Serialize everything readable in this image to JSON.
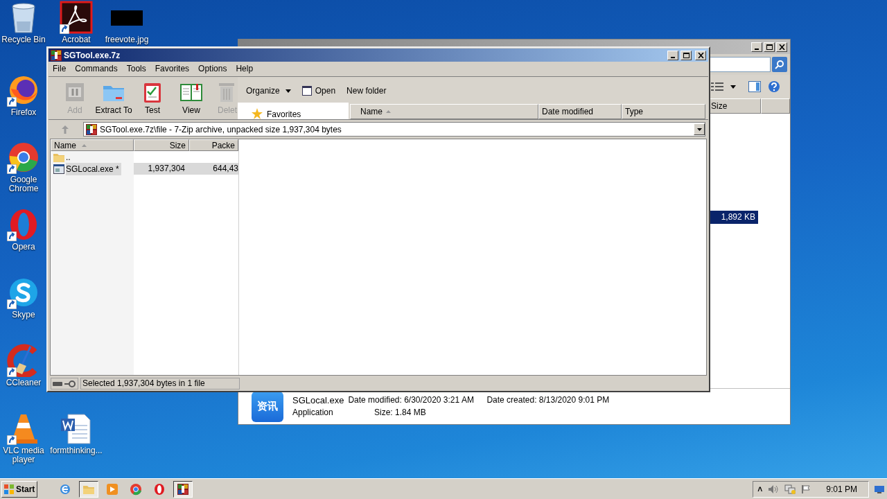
{
  "desktop_icons": [
    {
      "label": "Recycle Bin",
      "kind": "recycle",
      "shortcut": false
    },
    {
      "label": "Acrobat",
      "kind": "acrobat",
      "shortcut": true
    },
    {
      "label": "freevote.jpg",
      "kind": "image",
      "shortcut": false
    },
    {
      "label": "Firefox",
      "kind": "firefox",
      "shortcut": true
    },
    {
      "label": "Google Chrome",
      "kind": "chrome",
      "shortcut": true
    },
    {
      "label": "Opera",
      "kind": "opera",
      "shortcut": true
    },
    {
      "label": "Skype",
      "kind": "skype",
      "shortcut": true
    },
    {
      "label": "CCleaner",
      "kind": "ccleaner",
      "shortcut": true
    },
    {
      "label": "VLC media player",
      "kind": "vlc",
      "shortcut": true
    },
    {
      "label": "formthinking...",
      "kind": "word",
      "shortcut": false
    }
  ],
  "explorer_window": {
    "columns": [
      "Size"
    ],
    "selected_row": {
      "size": "1,892 KB",
      "selected": true
    },
    "details": {
      "icon_text": "资讯",
      "name": "SGLocal.exe",
      "type": "Application",
      "date_modified": "Date modified: 6/30/2020 3:21 AM",
      "size": "Size: 1.84 MB",
      "date_created": "Date created: 8/13/2020 9:01 PM"
    }
  },
  "archive_window": {
    "title": "SGTool.exe.7z",
    "menu": [
      "File",
      "Commands",
      "Tools",
      "Favorites",
      "Options",
      "Help"
    ],
    "toolbar": [
      {
        "label": "Add",
        "kind": "add",
        "disabled": true
      },
      {
        "label": "Extract To",
        "kind": "extract",
        "disabled": false
      },
      {
        "label": "Test",
        "kind": "test",
        "disabled": false
      },
      {
        "label": "View",
        "kind": "view",
        "disabled": false
      },
      {
        "label": "Delet",
        "kind": "delete",
        "disabled": true
      }
    ],
    "dialog_toolbar": [
      {
        "label": "Organize",
        "kind": "menu"
      },
      {
        "label": "Open",
        "kind": "open"
      },
      {
        "label": "New folder",
        "kind": "plain"
      }
    ],
    "favorites": "Favorites",
    "dialog_columns": [
      {
        "label": "Name",
        "sorted": true
      },
      {
        "label": "Date modified",
        "sorted": false
      },
      {
        "label": "Type",
        "sorted": false
      }
    ],
    "address": "SGTool.exe.7z\\file - 7-Zip archive, unpacked size 1,937,304 bytes",
    "columns": [
      {
        "label": "Name",
        "sorted": true
      },
      {
        "label": "Size",
        "sorted": false
      },
      {
        "label": "Packe",
        "sorted": false
      }
    ],
    "rows": [
      {
        "name": "..",
        "kind": "folder",
        "size": "",
        "packed": "",
        "selected": false
      },
      {
        "name": "SGLocal.exe *",
        "kind": "file",
        "size": "1,937,304",
        "packed": "644,43",
        "selected": true
      }
    ],
    "status": "Selected 1,937,304 bytes in 1 file"
  },
  "taskbar": {
    "start": "Start",
    "apps": [
      {
        "kind": "ie",
        "active": false
      },
      {
        "kind": "explorer",
        "active": true
      },
      {
        "kind": "media",
        "active": false
      },
      {
        "kind": "chrome",
        "active": false
      },
      {
        "kind": "opera",
        "active": false
      },
      {
        "kind": "sevenzip",
        "active": true
      }
    ],
    "tray": {
      "expander": "˄",
      "clock": "9:01 PM"
    }
  }
}
